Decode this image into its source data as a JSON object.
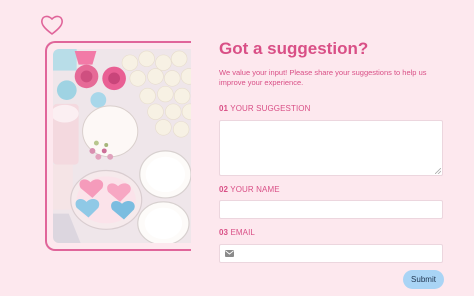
{
  "form": {
    "title": "Got a suggestion?",
    "subtitle": "We value your input! Please share your suggestions to help us improve your experience.",
    "fields": [
      {
        "number": "01",
        "label": "YOUR SUGGESTION",
        "value": "",
        "placeholder": ""
      },
      {
        "number": "02",
        "label": "YOUR NAME",
        "value": "",
        "placeholder": ""
      },
      {
        "number": "03",
        "label": "EMAIL",
        "value": "",
        "placeholder": ""
      }
    ],
    "submit_label": "Submit"
  },
  "icons": {
    "logo": "heart-outline-icon",
    "email": "mail-icon"
  },
  "colors": {
    "background": "#fde8ee",
    "accent": "#d94f86",
    "frame": "#e0659a",
    "submit": "#a9d4f5"
  }
}
